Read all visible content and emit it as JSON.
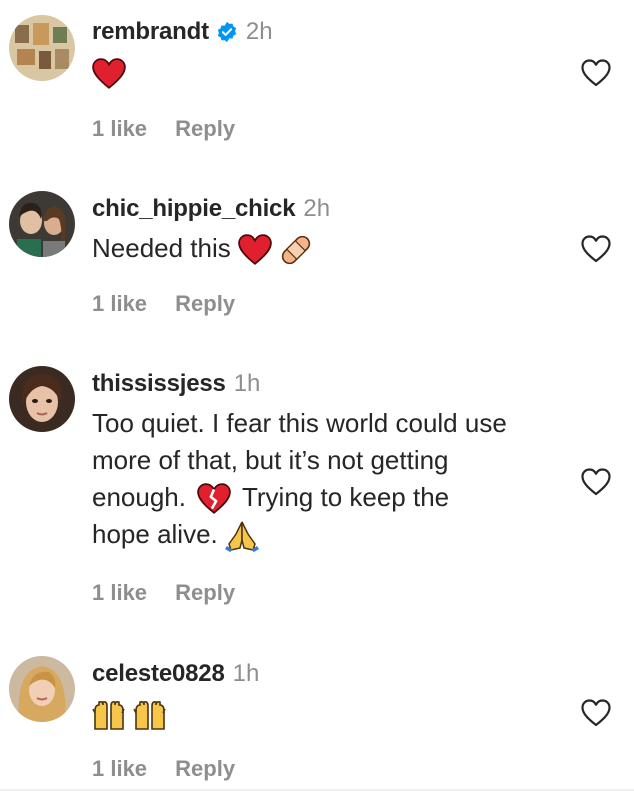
{
  "comments": [
    {
      "username": "rembrandt",
      "verified": true,
      "time": "2h",
      "text": "",
      "emojis": [
        "red-heart"
      ],
      "likes": "1 like",
      "reply": "Reply"
    },
    {
      "username": "chic_hippie_chick",
      "verified": false,
      "time": "2h",
      "text": "Needed this",
      "emojis": [
        "red-heart",
        "adhesive-bandage"
      ],
      "likes": "1 like",
      "reply": "Reply"
    },
    {
      "username": "thississjess",
      "verified": false,
      "time": "1h",
      "text_lines": [
        "Too quiet. I fear this world could use",
        "more of that, but it’s not getting",
        "enough.",
        "Trying to keep the",
        "hope alive."
      ],
      "emojis": [
        "broken-heart",
        "folded-hands"
      ],
      "likes": "1 like",
      "reply": "Reply"
    },
    {
      "username": "celeste0828",
      "verified": false,
      "time": "1h",
      "text": "",
      "emojis": [
        "raising-hands",
        "raising-hands"
      ],
      "likes": "1 like",
      "reply": "Reply"
    }
  ],
  "colors": {
    "text": "#262626",
    "secondary": "#8e8e8e",
    "verified_blue": "#0095f6",
    "heart_red": "#e0202e"
  }
}
